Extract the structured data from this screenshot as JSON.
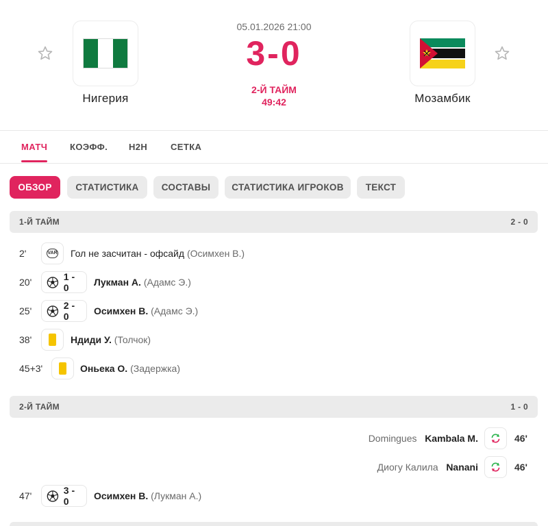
{
  "match": {
    "datetime": "05.01.2026 21:00",
    "score": "3-0",
    "period": "2-Й ТАЙМ",
    "clock": "49:42",
    "home": {
      "name": "Нигерия",
      "flag": "nigeria-flag"
    },
    "away": {
      "name": "Мозамбик",
      "flag": "mozambique-flag"
    }
  },
  "main_tabs": [
    {
      "label": "МАТЧ",
      "active": true
    },
    {
      "label": "КОЭФФ."
    },
    {
      "label": "H2H"
    },
    {
      "label": "СЕТКА"
    }
  ],
  "sub_tabs": [
    {
      "label": "ОБЗОР",
      "active": true
    },
    {
      "label": "СТАТИСТИКА"
    },
    {
      "label": "СОСТАВЫ"
    },
    {
      "label": "СТАТИСТИКА ИГРОКОВ"
    },
    {
      "label": "ТЕКСТ"
    }
  ],
  "first_half": {
    "title": "1-Й ТАЙМ",
    "score": "2 - 0",
    "events": [
      {
        "minute": "2'",
        "icon": "var-icon",
        "main": "Гол не засчитан - офсайд",
        "detail": "(Осимхен В.)"
      },
      {
        "minute": "20'",
        "icon": "ball-icon",
        "score": "1 - 0",
        "player": "Лукман А.",
        "detail": "(Адамс Э.)"
      },
      {
        "minute": "25'",
        "icon": "ball-icon",
        "score": "2 - 0",
        "player": "Осимхен В.",
        "detail": "(Адамс Э.)"
      },
      {
        "minute": "38'",
        "icon": "yellow-card-icon",
        "player": "Ндиди У.",
        "detail": "(Толчок)"
      },
      {
        "minute": "45+3'",
        "icon": "yellow-card-icon",
        "player": " Оньека О.",
        "detail": "(Задержка)"
      }
    ]
  },
  "second_half": {
    "title": "2-Й ТАЙМ",
    "score": "1 - 0",
    "subs": [
      {
        "minute": "46'",
        "player_in": "Kambala M.",
        "player_out": "Domingues",
        "icon": "substitution-icon"
      },
      {
        "minute": "46'",
        "player_in": "Nanani",
        "player_out": "Диогу Калила",
        "icon": "substitution-icon"
      }
    ],
    "events": [
      {
        "minute": "47'",
        "icon": "ball-icon",
        "score": "3 - 0",
        "player": "Осимхен В.",
        "detail": "(Лукман А.)"
      }
    ]
  },
  "colors": {
    "accent": "#e0245e",
    "card_yellow": "#f5c400",
    "sub_green": "#2bb24c",
    "sub_red": "#e0245e"
  }
}
